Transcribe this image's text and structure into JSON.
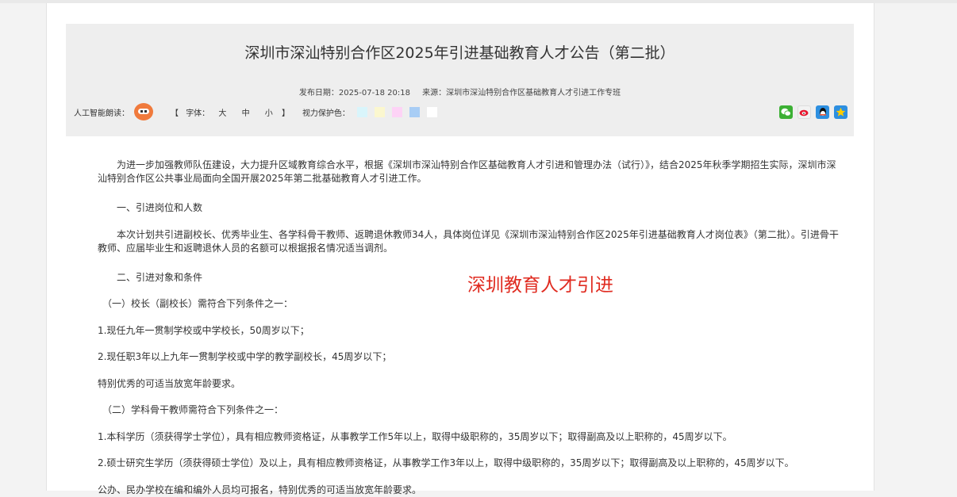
{
  "article": {
    "title": "深圳市深汕特别合作区2025年引进基础教育人才公告（第二批）",
    "publish_label": "发布日期：",
    "publish_date": "2025-07-18 20:18",
    "source_label": "来源：",
    "source": "深圳市深汕特别合作区基础教育人才引进工作专班"
  },
  "toolbar": {
    "ai_read_label": "人工智能朗读：",
    "font_open": "【",
    "font_label": "字体：",
    "font_large": "大",
    "font_medium": "中",
    "font_small": "小",
    "font_close": "】",
    "vision_label": "视力保护色：",
    "vision_colors": [
      "#d9f5fb",
      "#fbf7cf",
      "#fdd3f6",
      "#a8cdf5",
      "#ffffff"
    ],
    "share_icons": [
      "wechat-icon",
      "weibo-icon",
      "qq-icon",
      "qzone-icon"
    ]
  },
  "content": {
    "p1": "为进一步加强教师队伍建设，大力提升区域教育综合水平，根据《深圳市深汕特别合作区基础教育人才引进和管理办法（试行）》，结合2025年秋季学期招生实际，深圳市深汕特别合作区公共事业局面向全国开展2025年第二批基础教育人才引进工作。",
    "h1": "一、引进岗位和人数",
    "p2": "本次计划共引进副校长、优秀毕业生、各学科骨干教师、返聘退休教师34人，具体岗位详见《深圳市深汕特别合作区2025年引进基础教育人才岗位表》（第二批）。引进骨干教师、应届毕业生和返聘退休人员的名额可以根据报名情况适当调剂。",
    "h2": "二、引进对象和条件",
    "s1": "（一）校长（副校长）需符合下列条件之一：",
    "s1_1": "1.现任九年一贯制学校或中学校长，50周岁以下；",
    "s1_2": "2.现任职3年以上九年一贯制学校或中学的教学副校长，45周岁以下；",
    "s1_3": "特别优秀的可适当放宽年龄要求。",
    "s2": "（二）学科骨干教师需符合下列条件之一：",
    "s2_1": "1.本科学历（须获得学士学位），具有相应教师资格证，从事教学工作5年以上，取得中级职称的，35周岁以下；取得副高及以上职称的，45周岁以下。",
    "s2_2": "2.硕士研究生学历（须获得硕士学位）及以上，具有相应教师资格证，从事教学工作3年以上，取得中级职称的，35周岁以下；取得副高及以上职称的，45周岁以下。",
    "s2_3": "公办、民办学校在编和编外人员均可报名，特别优秀的可适当放宽年龄要求。",
    "overlay": "深圳教育人才引进"
  }
}
